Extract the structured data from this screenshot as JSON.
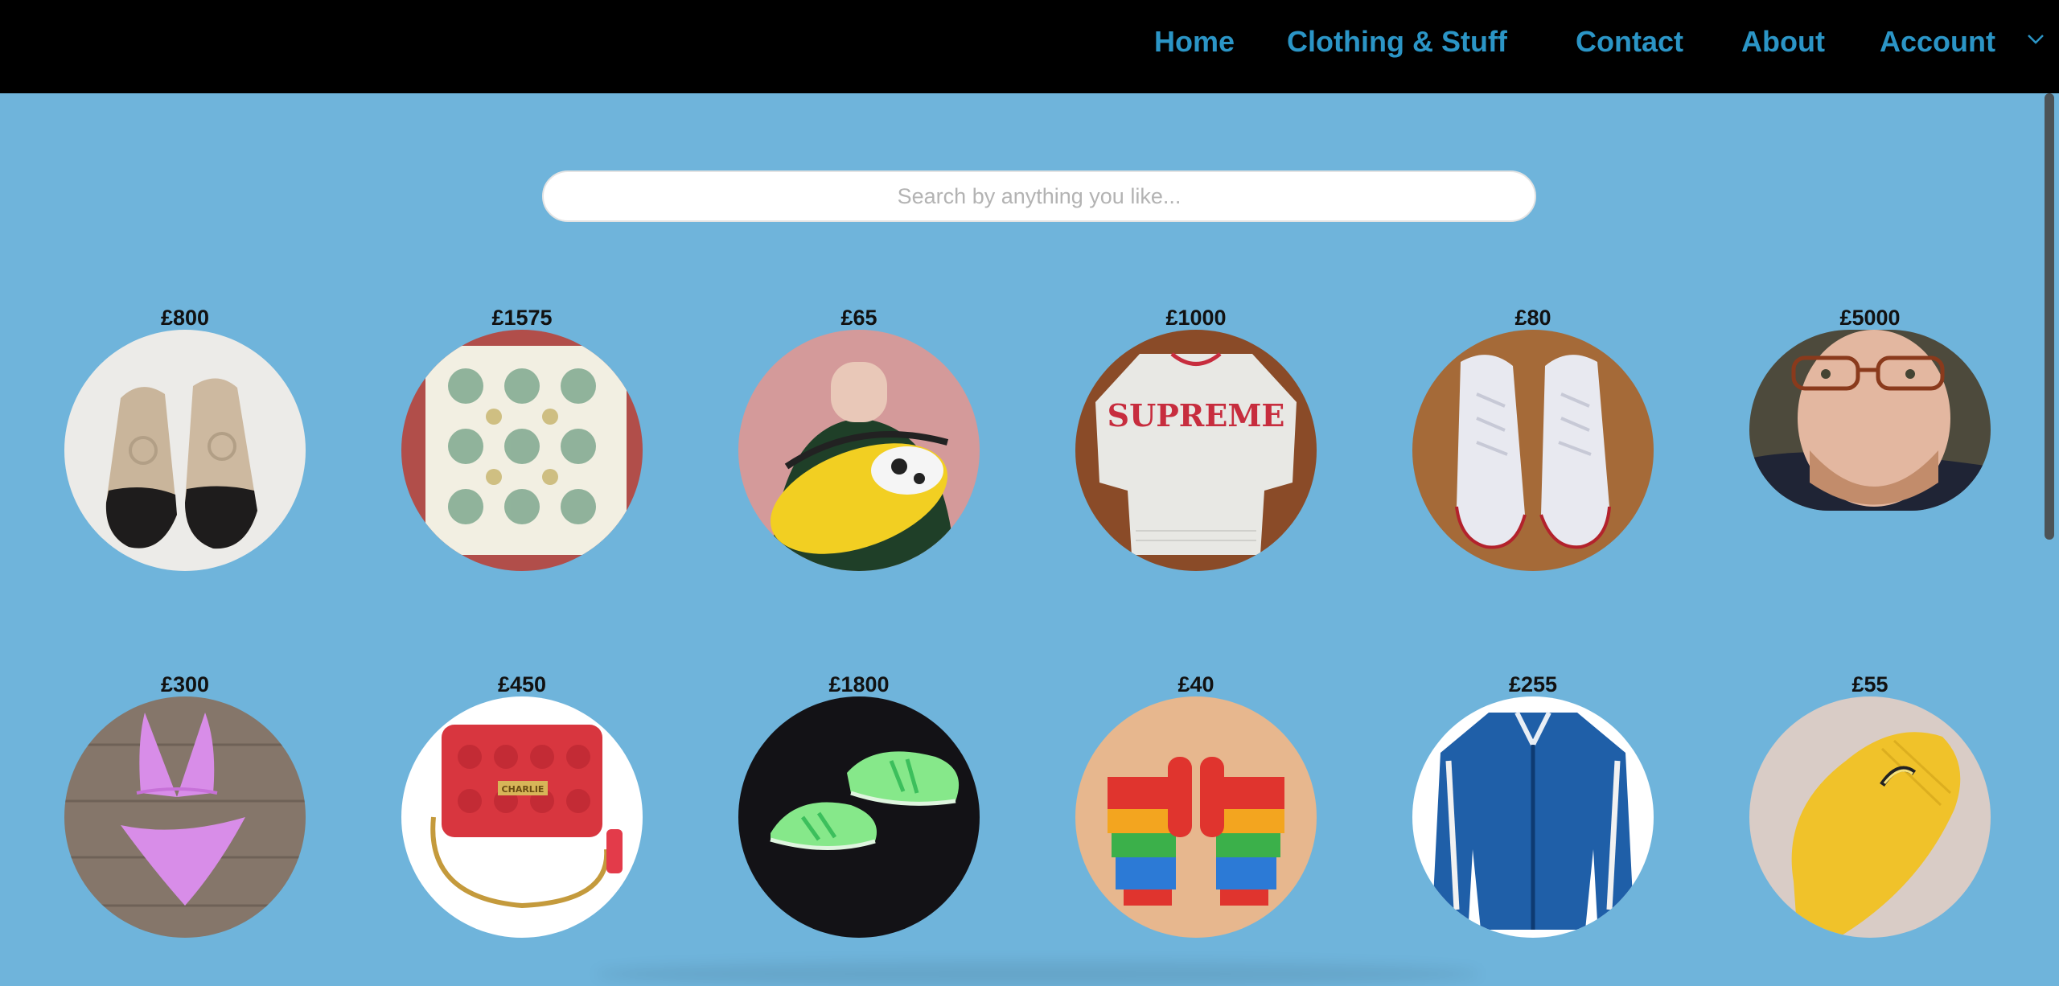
{
  "nav": {
    "items": [
      "Home",
      "Clothing & Stuff",
      "Contact",
      "About",
      "Account"
    ]
  },
  "search": {
    "placeholder": "Search by anything you like..."
  },
  "products": [
    {
      "price": "£800",
      "icon": "espadrilles-image"
    },
    {
      "price": "£1575",
      "icon": "scarf-image"
    },
    {
      "price": "£65",
      "icon": "fur-bumbag-image"
    },
    {
      "price": "£1000",
      "icon": "supreme-sweater-image"
    },
    {
      "price": "£80",
      "icon": "converse-sneakers-image"
    },
    {
      "price": "£5000",
      "icon": "portrait-image"
    },
    {
      "price": "£300",
      "icon": "bikini-image"
    },
    {
      "price": "£450",
      "icon": "red-handbag-image"
    },
    {
      "price": "£1800",
      "icon": "green-sneakers-image"
    },
    {
      "price": "£40",
      "icon": "rainbow-mittens-image"
    },
    {
      "price": "£255",
      "icon": "blue-jacket-image"
    },
    {
      "price": "£55",
      "icon": "banana-socks-image"
    }
  ],
  "product_images": {
    "p5_text": "SUPREME",
    "p8_text": "CHARLIE"
  },
  "colors": {
    "background": "#6fb4db",
    "navbar": "#000000",
    "nav_link": "#2b95c6"
  }
}
